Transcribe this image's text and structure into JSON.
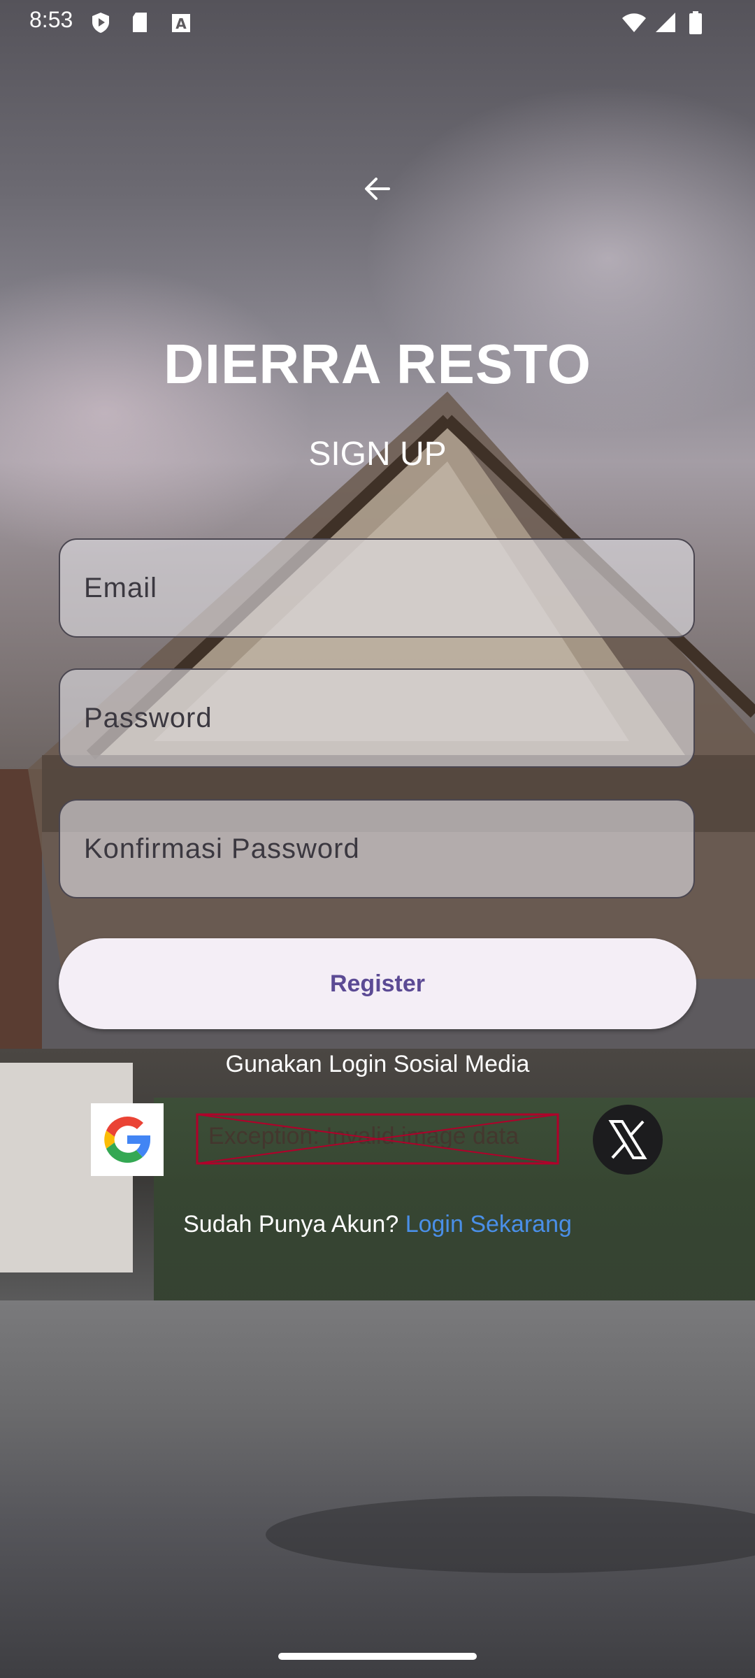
{
  "status_bar": {
    "time": "8:53",
    "left_icons": [
      "shield-icon",
      "sd-card-icon",
      "font-icon"
    ],
    "right_icons": [
      "wifi-icon",
      "signal-icon",
      "battery-icon"
    ]
  },
  "header": {
    "brand": "DIERRA RESTO",
    "subtitle": "SIGN UP"
  },
  "form": {
    "email_placeholder": "Email",
    "password_placeholder": "Password",
    "confirm_placeholder": "Konfirmasi Password",
    "register_label": "Register"
  },
  "social": {
    "caption": "Gunakan Login Sosial Media",
    "broken_image_text": "Exception: Invalid image data"
  },
  "footer": {
    "prompt": "Sudah Punya Akun? ",
    "link": "Login Sekarang"
  },
  "colors": {
    "accent": "#5b4a94",
    "link": "#4a8fe8"
  }
}
